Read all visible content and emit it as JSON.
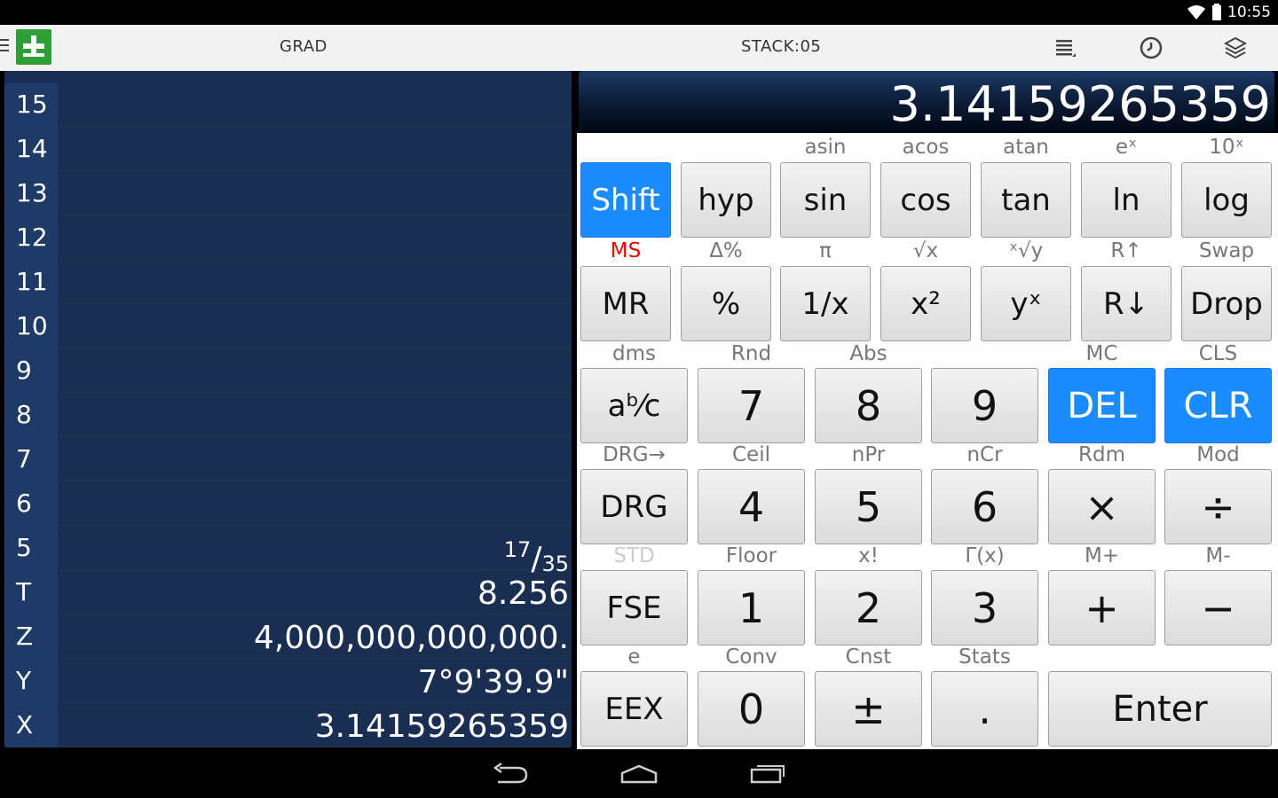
{
  "status_bar": {
    "time": "10:55"
  },
  "action_bar": {
    "angle_mode": "GRAD",
    "stack_label": "STACK:05"
  },
  "stack": [
    {
      "index": "15",
      "value": ""
    },
    {
      "index": "14",
      "value": ""
    },
    {
      "index": "13",
      "value": ""
    },
    {
      "index": "12",
      "value": ""
    },
    {
      "index": "11",
      "value": ""
    },
    {
      "index": "10",
      "value": ""
    },
    {
      "index": "9",
      "value": ""
    },
    {
      "index": "8",
      "value": ""
    },
    {
      "index": "7",
      "value": ""
    },
    {
      "index": "6",
      "value": ""
    },
    {
      "index": "5",
      "value": "",
      "frac_num": "17",
      "frac_slash": "/",
      "frac_den": "35"
    },
    {
      "index": "T",
      "value": "8.256"
    },
    {
      "index": "Z",
      "value": "4,000,000,000,000."
    },
    {
      "index": "Y",
      "value": "7°9'39.9\""
    },
    {
      "index": "X",
      "value": "3.14159265359"
    }
  ],
  "display": {
    "value": "3.14159265359"
  },
  "keypad": {
    "row1_subs": [
      "",
      "",
      "asin",
      "acos",
      "atan",
      "eˣ",
      "10ˣ"
    ],
    "row1_keys": [
      "Shift",
      "hyp",
      "sin",
      "cos",
      "tan",
      "ln",
      "log"
    ],
    "row2_subs": [
      "MS",
      "Δ%",
      "π",
      "√x",
      "ˣ√y",
      "R↑",
      "Swap"
    ],
    "row2_keys": [
      "MR",
      "%",
      "1/x",
      "x²",
      "yˣ",
      "R↓",
      "Drop"
    ],
    "row3_subs": [
      "dms",
      "Rnd",
      "Abs",
      "",
      "MC",
      "CLS"
    ],
    "row3_keys": [
      "aᵇ⁄c",
      "7",
      "8",
      "9",
      "DEL",
      "CLR"
    ],
    "row4_subs": [
      "DRG→",
      "Ceil",
      "nPr",
      "nCr",
      "Rdm",
      "Mod"
    ],
    "row4_keys": [
      "DRG",
      "4",
      "5",
      "6",
      "×",
      "÷"
    ],
    "row5_subs": [
      "STD",
      "Floor",
      "x!",
      "Γ(x)",
      "M+",
      "M-"
    ],
    "row5_keys": [
      "FSE",
      "1",
      "2",
      "3",
      "+",
      "−"
    ],
    "row6_subs": [
      "e",
      "Conv",
      "Cnst",
      "Stats"
    ],
    "row6_keys": [
      "EEX",
      "0",
      "±",
      ".",
      "Enter"
    ]
  },
  "colors": {
    "accent_blue": "#1a8cff",
    "stack_bg": "#1a2e52",
    "app_icon_green": "#2e9e36",
    "memory_red": "#e00000"
  },
  "icons": [
    "menu-icon",
    "app-icon",
    "history-icon",
    "clock-icon",
    "layers-icon",
    "wifi-icon",
    "battery-icon",
    "back-icon",
    "home-icon",
    "recent-apps-icon"
  ]
}
